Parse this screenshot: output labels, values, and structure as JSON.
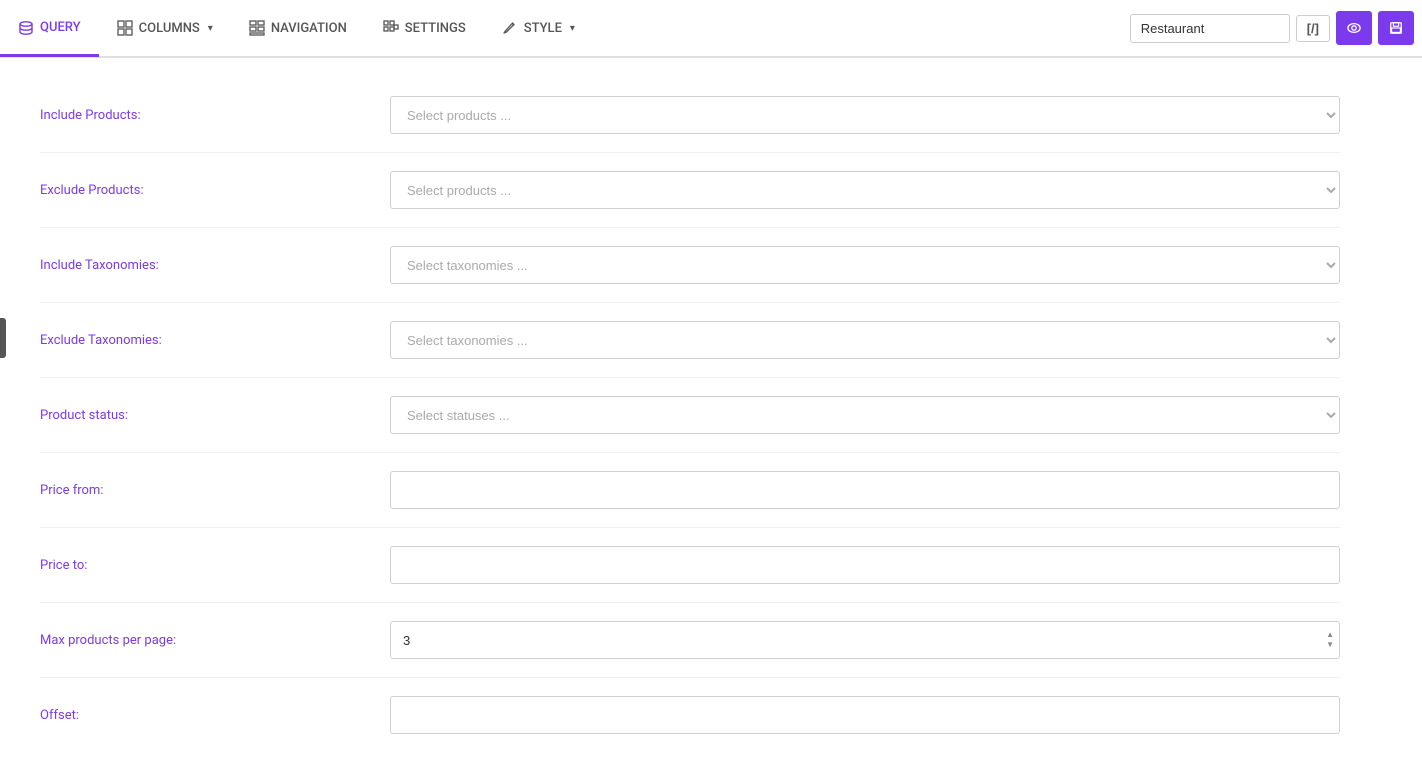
{
  "topNav": {
    "tabs": [
      {
        "id": "query",
        "label": "QUERY",
        "active": true,
        "icon": "database"
      },
      {
        "id": "columns",
        "label": "COLUMNS",
        "active": false,
        "icon": "grid",
        "hasDropdown": true
      },
      {
        "id": "navigation",
        "label": "NAVIGATION",
        "active": false,
        "icon": "grid-nav"
      },
      {
        "id": "settings",
        "label": "SETTINGS",
        "active": false,
        "icon": "settings"
      },
      {
        "id": "style",
        "label": "STYLE",
        "active": false,
        "icon": "pencil",
        "hasDropdown": true
      }
    ],
    "restaurantPlaceholder": "Restaurant",
    "bracketLabel": "[/]"
  },
  "form": {
    "fields": [
      {
        "id": "include-products",
        "label": "Include Products:",
        "type": "select",
        "placeholder": "Select products ..."
      },
      {
        "id": "exclude-products",
        "label": "Exclude Products:",
        "type": "select",
        "placeholder": "Select products ..."
      },
      {
        "id": "include-taxonomies",
        "label": "Include Taxonomies:",
        "type": "select",
        "placeholder": "Select taxonomies ..."
      },
      {
        "id": "exclude-taxonomies",
        "label": "Exclude Taxonomies:",
        "type": "select",
        "placeholder": "Select taxonomies ..."
      },
      {
        "id": "product-status",
        "label": "Product status:",
        "type": "select",
        "placeholder": "Select statuses ..."
      },
      {
        "id": "price-from",
        "label": "Price from:",
        "type": "input",
        "placeholder": "",
        "value": ""
      },
      {
        "id": "price-to",
        "label": "Price to:",
        "type": "input",
        "placeholder": "",
        "value": ""
      },
      {
        "id": "max-products-per-page",
        "label": "Max products per page:",
        "type": "number",
        "value": "3"
      },
      {
        "id": "offset",
        "label": "Offset:",
        "type": "input",
        "placeholder": "",
        "value": ""
      }
    ]
  }
}
